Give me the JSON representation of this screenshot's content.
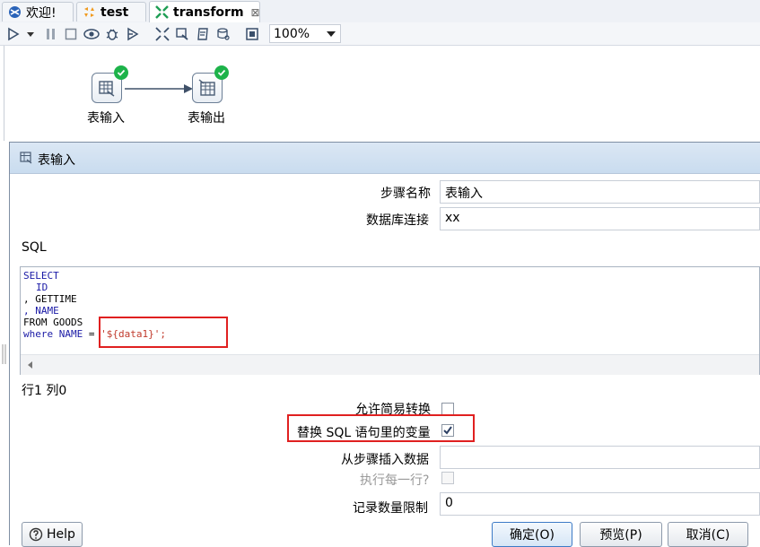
{
  "tabs": [
    {
      "label": "欢迎!",
      "icon": "globe-icon",
      "active": false
    },
    {
      "label": "test",
      "icon": "job-icon",
      "active": false
    },
    {
      "label": "transform",
      "icon": "transform-icon",
      "active": true,
      "close": "⊠"
    }
  ],
  "toolbar": {
    "zoom": "100%"
  },
  "canvas": {
    "steps": [
      {
        "label": "表输入"
      },
      {
        "label": "表输出"
      }
    ]
  },
  "dialog": {
    "title": "表输入",
    "step_name_label": "步骤名称",
    "step_name_value": "表输入",
    "db_conn_label": "数据库连接",
    "db_conn_value": "xx",
    "sql_label": "SQL",
    "sql_lines": [
      "SELECT",
      "ID",
      ", GETTIME",
      ", NAME",
      "FROM GOODS",
      "where NAME = '${data1}';"
    ],
    "cursor_pos": "行1 列0",
    "lazy_conversion_label": "允许简易转换",
    "replace_vars_label": "替换 SQL 语句里的变量",
    "replace_vars_checked": true,
    "insert_from_step_label": "从步骤插入数据",
    "exec_each_row_label": "执行每一行?",
    "limit_label": "记录数量限制",
    "limit_value": "0",
    "help_label": "Help",
    "ok_label": "确定(O)",
    "preview_label": "预览(P)",
    "cancel_label": "取消(C)"
  },
  "colors": {
    "highlight": "#e02020",
    "success": "#1db34a",
    "keyword": "#1a1aa6",
    "string": "#c0392b"
  }
}
